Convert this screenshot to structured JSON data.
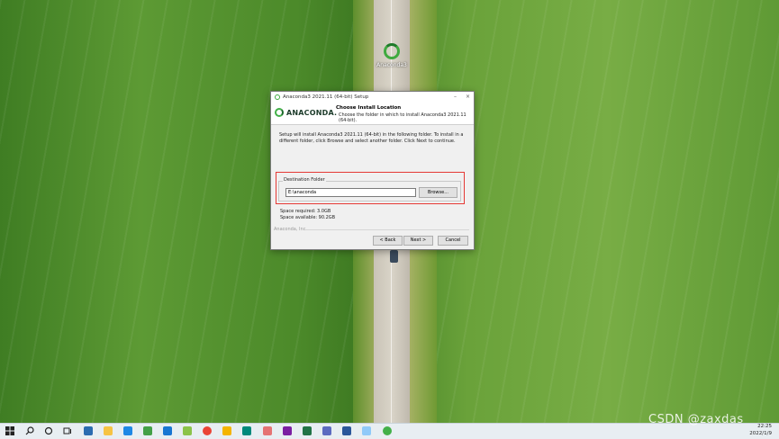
{
  "desktop": {
    "icon_label": "Anaconda3"
  },
  "window": {
    "title": "Anaconda3 2021.11 (64-bit) Setup",
    "controls": {
      "minimize": "–",
      "close": "×"
    },
    "logo_text": "ANACONDA.",
    "header_title": "Choose Install Location",
    "header_subtitle": "Choose the folder in which to install Anaconda3 2021.11 (64-bit).",
    "body_text": "Setup will install Anaconda3 2021.11 (64-bit) in the following folder. To install in a different folder, click Browse and select another folder. Click Next to continue.",
    "destination_label": "Destination Folder",
    "destination_value": "E:\\anaconda",
    "browse_label": "Browse...",
    "space_required": "Space required: 3.0GB",
    "space_available": "Space available: 90.2GB",
    "brand_footer": "Anaconda, Inc.",
    "back_label": "< Back",
    "next_label": "Next >",
    "cancel_label": "Cancel"
  },
  "taskbar": {
    "start_icon": "windows-icon",
    "search_icon": "search-icon",
    "cortana_icon": "circle-icon",
    "taskview_icon": "task-view-icon",
    "time": "22:25",
    "date": "2022/1/9",
    "app_colors": [
      "#2b6cb0",
      "#f6c343",
      "#1e88e5",
      "#43a047",
      "#1976d2",
      "#8bc34a",
      "#ea4335",
      "#f4b400",
      "#00897b",
      "#e57373",
      "#7b1fa2",
      "#217346",
      "#5c6bc0",
      "#2b579a",
      "#90caf9",
      "#43b049"
    ]
  },
  "watermark": "CSDN @zaxdas"
}
